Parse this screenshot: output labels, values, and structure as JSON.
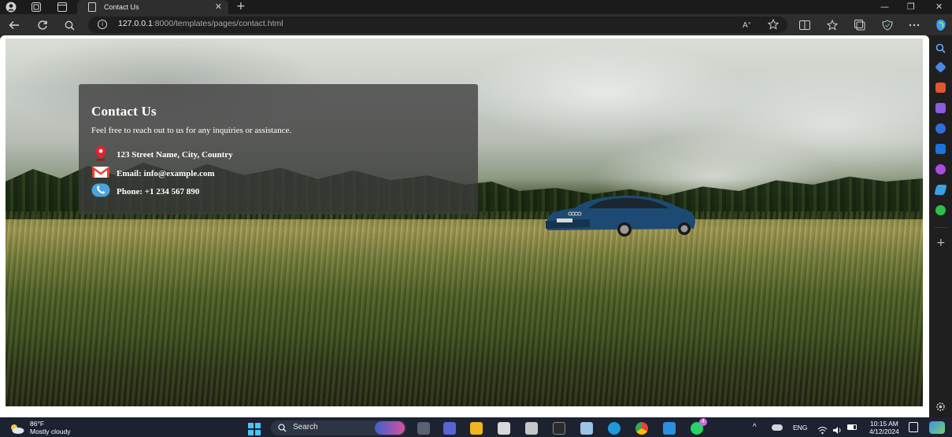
{
  "browser": {
    "tab_title": "Contact Us",
    "url_host": "127.0.0.1",
    "url_path": ":8000/templates/pages/contact.html",
    "new_tab": "+",
    "close_tab": "✕",
    "window_minimize": "—",
    "window_maximize": "❐",
    "window_close": "✕"
  },
  "contact": {
    "title": "Contact Us",
    "lead": "Feel free to reach out to us for any inquiries or assistance.",
    "items": [
      {
        "icon": "location-pin-icon",
        "label": "123 Street Name, City, Country"
      },
      {
        "icon": "email-icon",
        "label": "Email: info@example.com"
      },
      {
        "icon": "phone-icon",
        "label": "Phone: +1 234 567 890"
      }
    ]
  },
  "taskbar": {
    "weather_temp": "86°F",
    "weather_desc": "Mostly cloudy",
    "search_label": "Search",
    "language": "ENG",
    "time": "10:15 AM",
    "date": "4/12/2024",
    "whatsapp_badge": "4"
  },
  "colors": {
    "accent": "#4cc2ff",
    "pin": "#e8202a",
    "mail": "#e84030",
    "phone": "#4aa3df"
  }
}
